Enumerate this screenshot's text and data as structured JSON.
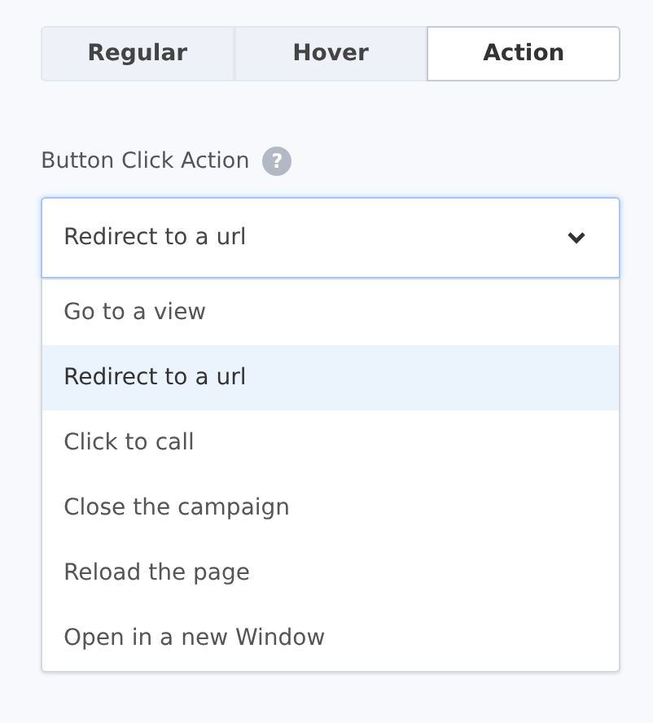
{
  "tabs": [
    {
      "label": "Regular",
      "selected": false
    },
    {
      "label": "Hover",
      "selected": false
    },
    {
      "label": "Action",
      "selected": true
    }
  ],
  "field": {
    "label": "Button Click Action",
    "help_icon": "?",
    "value": "Redirect to a url",
    "expanded": true
  },
  "options": [
    {
      "label": "Go to a view",
      "selected": false
    },
    {
      "label": "Redirect to a url",
      "selected": true
    },
    {
      "label": "Click to call",
      "selected": false
    },
    {
      "label": "Close the campaign",
      "selected": false
    },
    {
      "label": "Reload the page",
      "selected": false
    },
    {
      "label": "Open in a new Window",
      "selected": false
    }
  ]
}
